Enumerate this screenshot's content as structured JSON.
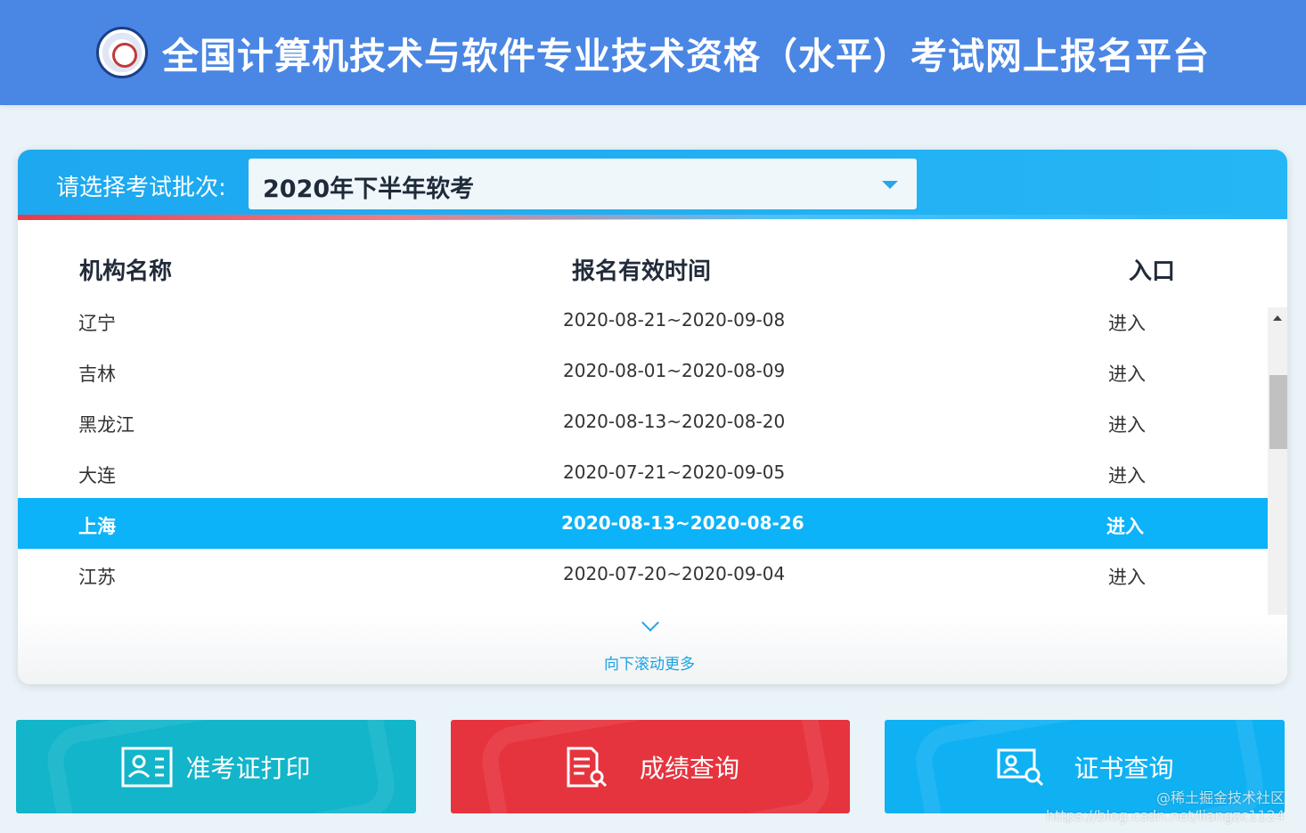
{
  "header": {
    "title": "全国计算机技术与软件专业技术资格（水平）考试网上报名平台",
    "logo_icon": "ruankao-logo-icon"
  },
  "selector": {
    "label": "请选择考试批次:",
    "value": "2020年下半年软考"
  },
  "table": {
    "columns": [
      "机构名称",
      "报名有效时间",
      "入口"
    ],
    "rows": [
      {
        "name": "辽宁",
        "time": "2020-08-21~2020-09-08",
        "entry": "进入"
      },
      {
        "name": "吉林",
        "time": "2020-08-01~2020-08-09",
        "entry": "进入"
      },
      {
        "name": "黑龙江",
        "time": "2020-08-13~2020-08-20",
        "entry": "进入"
      },
      {
        "name": "大连",
        "time": "2020-07-21~2020-09-05",
        "entry": "进入"
      },
      {
        "name": "上海",
        "time": "2020-08-13~2020-08-26",
        "entry": "进入"
      },
      {
        "name": "江苏",
        "time": "2020-07-20~2020-09-04",
        "entry": "进入"
      }
    ],
    "active_row": 4,
    "scroll_more": "向下滚动更多"
  },
  "buttons": {
    "admit": "准考证打印",
    "score": "成绩查询",
    "cert": "证书查询"
  },
  "watermark": {
    "line1": "@稀土掘金技术社区",
    "line2": "https://blog.csdn.net/liangzc1124"
  },
  "colors": {
    "header": "#4a86e4",
    "accent_blue": "#0cb3f8",
    "admit": "#12b5c9",
    "score": "#e6343e",
    "cert": "#10b1f3"
  }
}
